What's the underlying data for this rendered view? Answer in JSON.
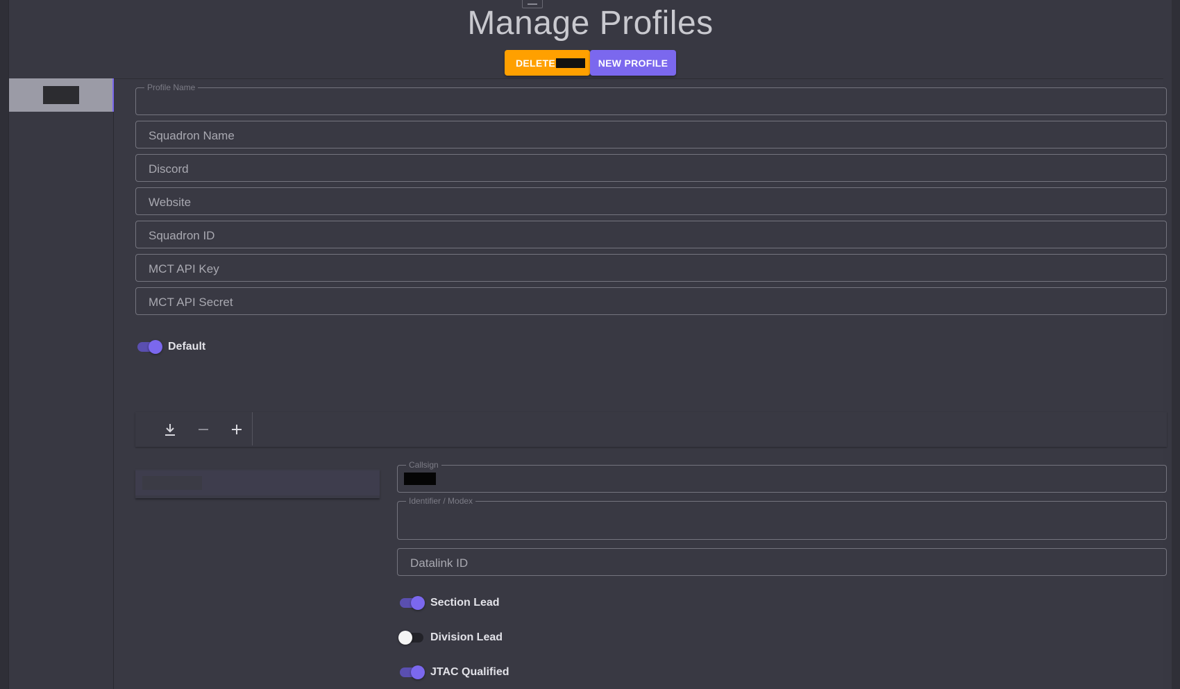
{
  "page": {
    "title": "Manage Profiles"
  },
  "actions": {
    "delete_label": "DELETE",
    "new_profile_label": "NEW PROFILE"
  },
  "colors": {
    "accent": "#7b68ee",
    "delete": "#ffa000",
    "background": "#383842"
  },
  "sidebar": {
    "items": [
      {
        "label": "",
        "selected": true
      }
    ]
  },
  "profile_form": {
    "profile_name": {
      "label": "Profile Name",
      "value": ""
    },
    "squadron_name": {
      "placeholder": "Squadron Name",
      "value": ""
    },
    "discord": {
      "placeholder": "Discord",
      "value": ""
    },
    "website": {
      "placeholder": "Website",
      "value": ""
    },
    "squadron_id": {
      "placeholder": "Squadron ID",
      "value": ""
    },
    "mct_api_key": {
      "placeholder": "MCT API Key",
      "value": ""
    },
    "mct_api_secret": {
      "placeholder": "MCT API Secret",
      "value": ""
    },
    "default_toggle": {
      "label": "Default",
      "checked": true
    }
  },
  "pilot_toolbar": {
    "icons": [
      "download-icon",
      "minus-icon",
      "plus-icon"
    ]
  },
  "pilot_form": {
    "callsign": {
      "label": "Callsign",
      "value": ""
    },
    "identifier": {
      "label": "Identifier / Modex",
      "value": ""
    },
    "datalink_id": {
      "placeholder": "Datalink ID",
      "value": ""
    },
    "section_lead": {
      "label": "Section Lead",
      "checked": true
    },
    "division_lead": {
      "label": "Division Lead",
      "checked": false
    },
    "jtac_qualified": {
      "label": "JTAC Qualified",
      "checked": true
    }
  }
}
